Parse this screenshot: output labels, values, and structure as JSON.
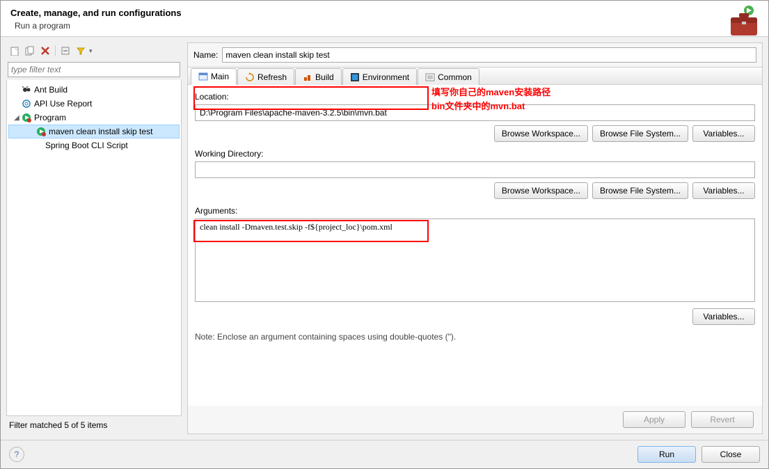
{
  "header": {
    "title": "Create, manage, and run configurations",
    "subtitle": "Run a program"
  },
  "filter": {
    "placeholder": "type filter text"
  },
  "tree": {
    "items": [
      {
        "label": "Ant Build",
        "icon": "ant"
      },
      {
        "label": "API Use Report",
        "icon": "at"
      },
      {
        "label": "Program",
        "icon": "prog",
        "expanded": true
      },
      {
        "label": "maven clean install skip test",
        "icon": "prog-child",
        "selected": true,
        "level": 3
      },
      {
        "label": "Spring Boot CLI Script",
        "level": 2
      }
    ]
  },
  "left_status": "Filter matched 5 of 5 items",
  "name": {
    "label": "Name:",
    "value": "maven clean install skip test"
  },
  "tabs": [
    {
      "id": "main",
      "label": "Main",
      "active": true
    },
    {
      "id": "refresh",
      "label": "Refresh"
    },
    {
      "id": "build",
      "label": "Build"
    },
    {
      "id": "environment",
      "label": "Environment"
    },
    {
      "id": "common",
      "label": "Common"
    }
  ],
  "main": {
    "location_label": "Location:",
    "location_value": "D:\\Program Files\\apache-maven-3.2.5\\bin\\mvn.bat",
    "working_label": "Working Directory:",
    "working_value": "",
    "arguments_label": "Arguments:",
    "arguments_value": "clean install -Dmaven.test.skip -f${project_loc}\\pom.xml",
    "note": "Note: Enclose an argument containing spaces using double-quotes (\").",
    "btn_browse_ws": "Browse Workspace...",
    "btn_browse_fs": "Browse File System...",
    "btn_variables": "Variables..."
  },
  "annotations": {
    "line1": "填写你自己的maven安装路径",
    "line2": "bin文件夹中的mvn.bat"
  },
  "buttons": {
    "apply": "Apply",
    "revert": "Revert",
    "run": "Run",
    "close": "Close"
  }
}
